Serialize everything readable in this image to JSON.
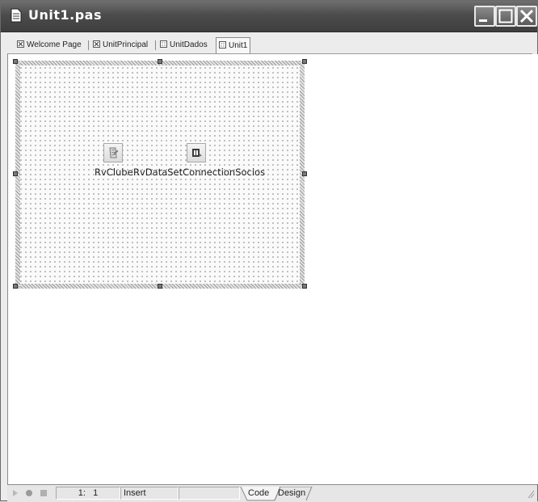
{
  "window": {
    "title": "Unit1.pas"
  },
  "tabs": [
    {
      "label": "Welcome Page",
      "icon": "close-box-icon"
    },
    {
      "label": "UnitPrincipal",
      "icon": "close-box-icon"
    },
    {
      "label": "UnitDados",
      "icon": "form-icon"
    },
    {
      "label": "Unit1",
      "icon": "form-icon",
      "active": true
    }
  ],
  "components": [
    {
      "name": "RvClube",
      "icon": "rave-project-icon"
    },
    {
      "name": "RvDataSetConnectionSocios",
      "icon": "rave-dataset-connection-icon"
    }
  ],
  "status": {
    "position": "1:   1",
    "mode": "Insert",
    "view_tabs": [
      "Code",
      "Design"
    ]
  }
}
